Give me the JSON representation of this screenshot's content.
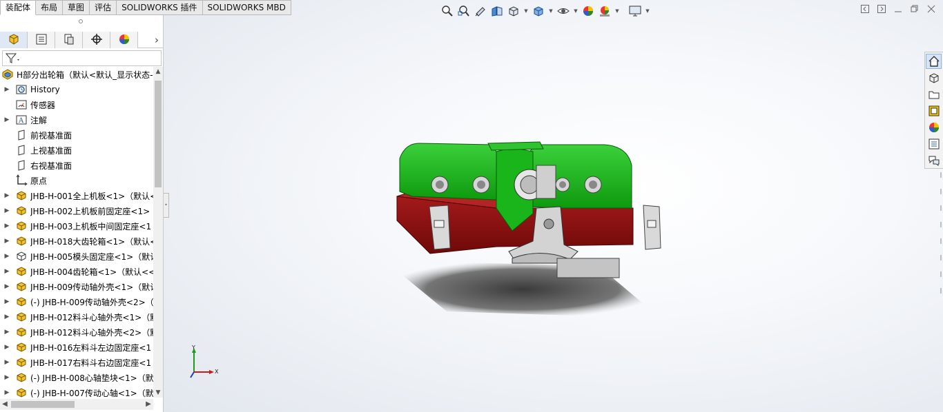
{
  "tabs": [
    "装配体",
    "布局",
    "草图",
    "评估",
    "SOLIDWORKS 插件",
    "SOLIDWORKS MBD"
  ],
  "active_tab": 0,
  "feature_tree": {
    "root": "H部分出轮箱（默认<默认_显示状态-",
    "items": [
      {
        "label": "History",
        "icon": "history-icon",
        "expandable": true
      },
      {
        "label": "传感器",
        "icon": "sensor-icon",
        "expandable": false
      },
      {
        "label": "注解",
        "icon": "annotation-icon",
        "expandable": true
      },
      {
        "label": "前视基准面",
        "icon": "plane-icon",
        "expandable": false
      },
      {
        "label": "上视基准面",
        "icon": "plane-icon",
        "expandable": false
      },
      {
        "label": "右视基准面",
        "icon": "plane-icon",
        "expandable": false
      },
      {
        "label": "原点",
        "icon": "origin-icon",
        "expandable": false
      },
      {
        "label": "JHB-H-001全上机板<1>（默认<",
        "icon": "part-icon",
        "expandable": true
      },
      {
        "label": "JHB-H-002上机板前固定座<1>",
        "icon": "part-icon",
        "expandable": true
      },
      {
        "label": "JHB-H-003上机板中间固定座<1",
        "icon": "part-icon",
        "expandable": true
      },
      {
        "label": "JHB-H-018大齿轮箱<1>（默认<",
        "icon": "part-icon",
        "expandable": true
      },
      {
        "label": "JHB-H-005模头固定座<1>（默认",
        "icon": "part-outline-icon",
        "expandable": true
      },
      {
        "label": "JHB-H-004齿轮箱<1>（默认<<",
        "icon": "part-icon",
        "expandable": true
      },
      {
        "label": "JHB-H-009传动轴外壳<1>（默认",
        "icon": "part-icon",
        "expandable": true
      },
      {
        "label": "(-) JHB-H-009传动轴外壳<2>（",
        "icon": "part-icon",
        "expandable": true
      },
      {
        "label": "JHB-H-012料斗心轴外壳<1>（默",
        "icon": "part-icon",
        "expandable": true
      },
      {
        "label": "JHB-H-012料斗心轴外壳<2>（默",
        "icon": "part-icon",
        "expandable": true
      },
      {
        "label": "JHB-H-016左料斗左边固定座<1",
        "icon": "part-icon",
        "expandable": true
      },
      {
        "label": "JHB-H-017右料斗右边固定座<1",
        "icon": "part-icon",
        "expandable": true
      },
      {
        "label": "(-) JHB-H-008心轴垫块<1>（默",
        "icon": "part-icon",
        "expandable": true
      },
      {
        "label": "(-) JHB-H-007传动心轴<1>（默",
        "icon": "part-icon",
        "expandable": true
      }
    ]
  },
  "panel_tabs": [
    "feature-manager-icon",
    "property-manager-icon",
    "configuration-manager-icon",
    "dimxpert-icon",
    "display-manager-icon"
  ],
  "view_toolbar": [
    "zoom-to-fit-icon",
    "zoom-area-icon",
    "previous-view-icon",
    "section-view-icon",
    "view-orientation-icon",
    "display-style-icon",
    "hide-show-icon",
    "edit-appearance-icon",
    "apply-scene-icon",
    "view-settings-icon"
  ],
  "task_pane": [
    "home-icon",
    "design-library-icon",
    "file-explorer-icon",
    "view-palette-icon",
    "appearances-icon",
    "custom-properties-icon",
    "forum-icon"
  ],
  "triad": {
    "x": "X",
    "y": "Y"
  },
  "colors": {
    "green": "#12b212",
    "red": "#8a0d0d",
    "gray": "#c8c8c8",
    "accent": "#2a5ea8"
  }
}
